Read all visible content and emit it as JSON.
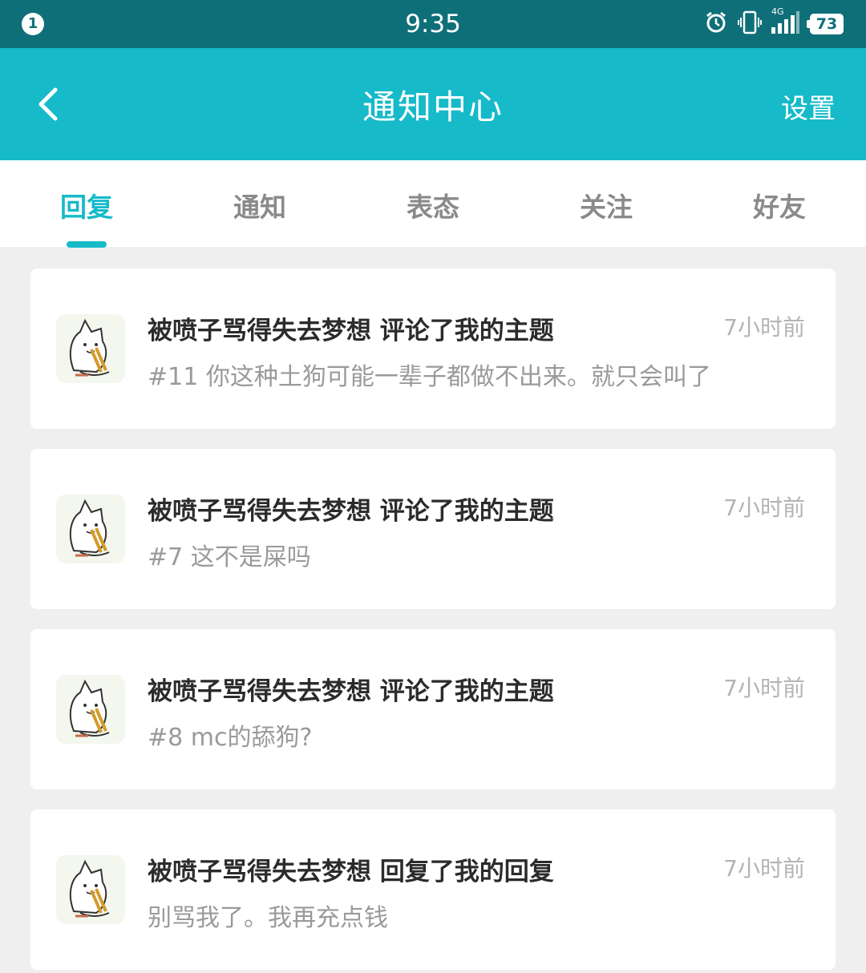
{
  "status_bar": {
    "notification_count": "1",
    "time": "9:35",
    "network_label": "4G",
    "battery_level": "73"
  },
  "app_bar": {
    "title": "通知中心",
    "settings_label": "设置"
  },
  "tabs": [
    {
      "label": "回复",
      "active": true
    },
    {
      "label": "通知",
      "active": false
    },
    {
      "label": "表态",
      "active": false
    },
    {
      "label": "关注",
      "active": false
    },
    {
      "label": "好友",
      "active": false
    }
  ],
  "notifications": [
    {
      "title": "被喷子骂得失去梦想 评论了我的主题",
      "time": "7小时前",
      "body": "#11 你这种土狗可能一辈子都做不出来。就只会叫了"
    },
    {
      "title": "被喷子骂得失去梦想 评论了我的主题",
      "time": "7小时前",
      "body": "#7 这不是屎吗"
    },
    {
      "title": "被喷子骂得失去梦想 评论了我的主题",
      "time": "7小时前",
      "body": "#8 mc的舔狗?"
    },
    {
      "title": "被喷子骂得失去梦想 回复了我的回复",
      "time": "7小时前",
      "body": "别骂我了。我再充点钱"
    }
  ],
  "colors": {
    "status_bar": "#0f6f78",
    "accent": "#16bac9",
    "background": "#efefef"
  }
}
